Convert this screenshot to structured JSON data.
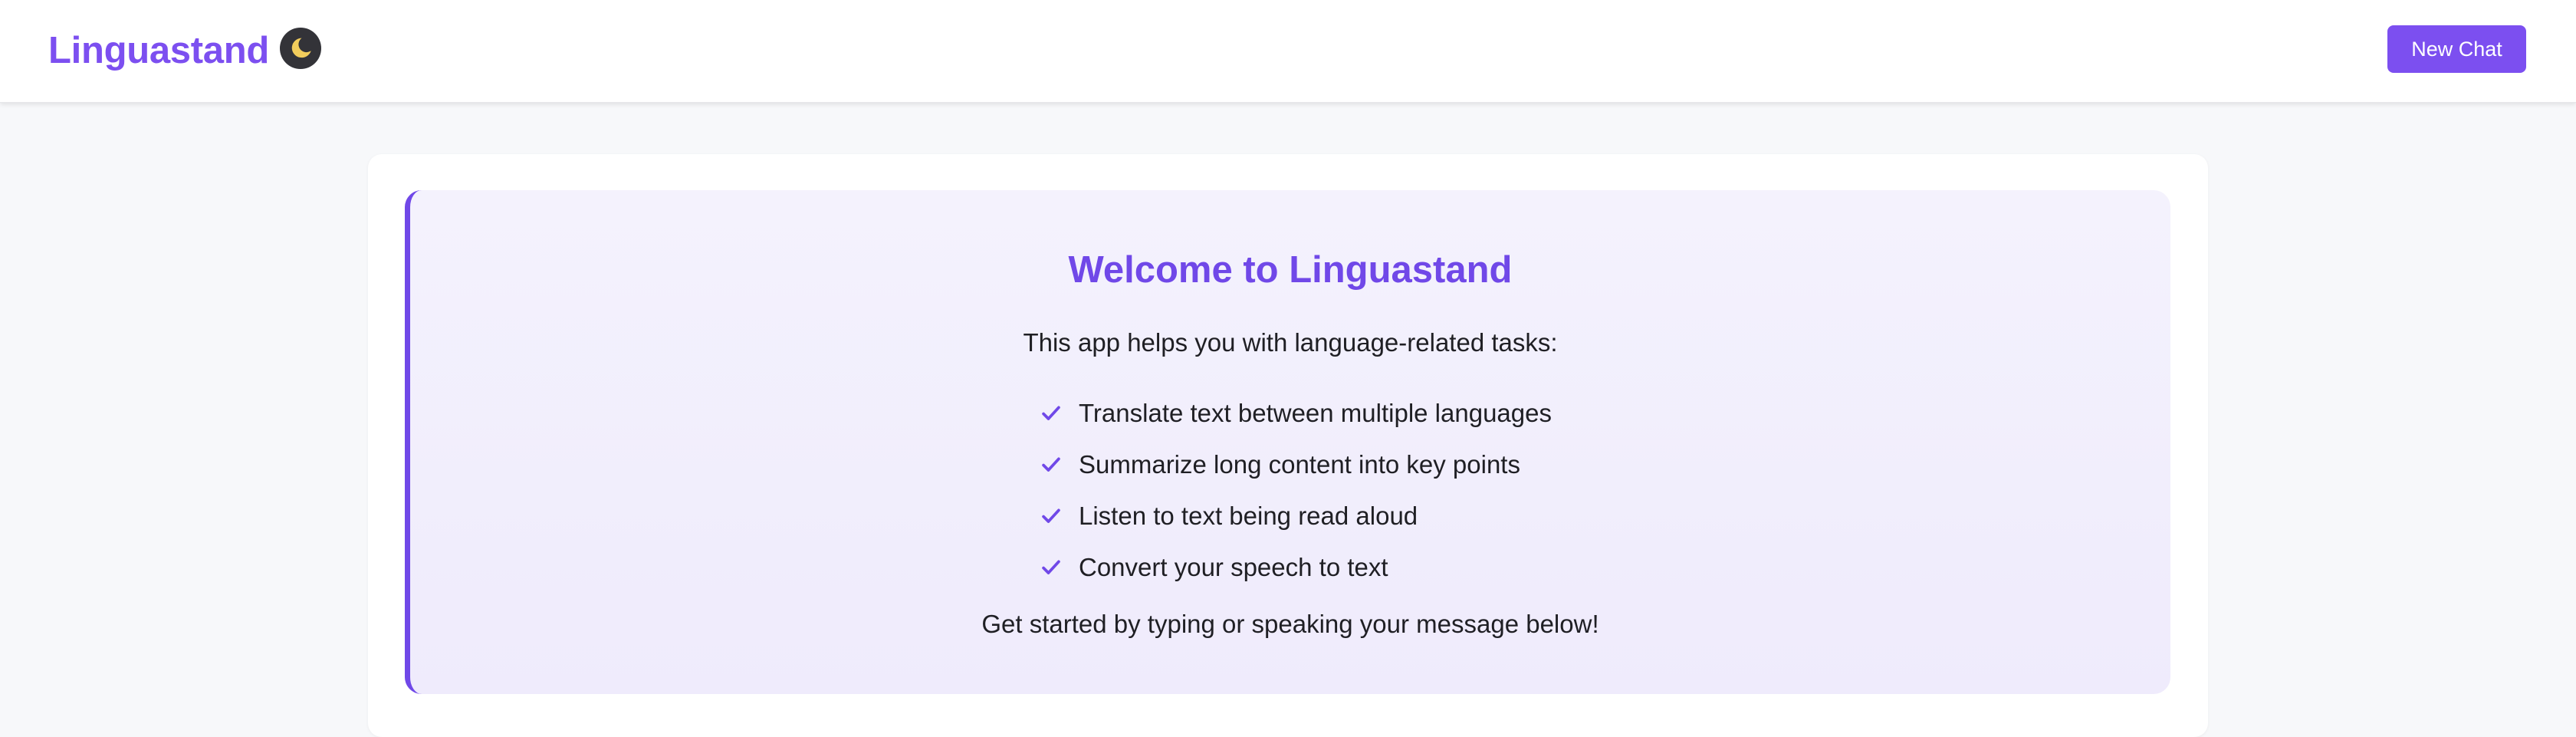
{
  "header": {
    "brand": "Linguastand",
    "theme_toggle_icon": "moon-icon",
    "new_chat_label": "New Chat"
  },
  "welcome": {
    "title": "Welcome to Linguastand",
    "intro": "This app helps you with language-related tasks:",
    "features": [
      {
        "icon": "check-icon",
        "label": "Translate text between multiple languages"
      },
      {
        "icon": "check-icon",
        "label": "Summarize long content into key points"
      },
      {
        "icon": "check-icon",
        "label": "Listen to text being read aloud"
      },
      {
        "icon": "check-icon",
        "label": "Convert your speech to text"
      }
    ],
    "outro": "Get started by typing or speaking your message below!"
  },
  "colors": {
    "accent": "#7c4ff0",
    "accent_dark": "#7048e8",
    "welcome_bg": "#f2effd",
    "page_bg": "#f7f8fa",
    "toggle_bg": "#333338",
    "moon": "#f2cd5c"
  }
}
